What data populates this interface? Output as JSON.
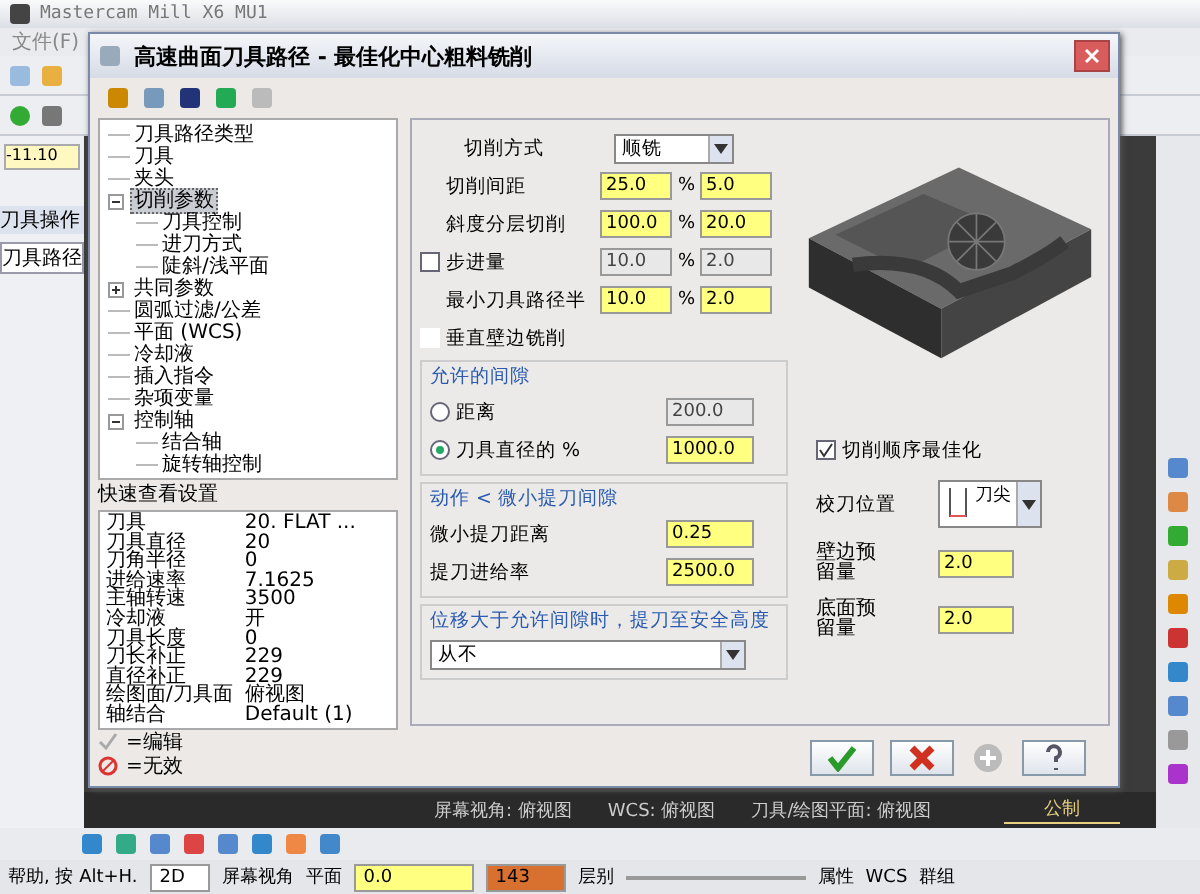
{
  "app": {
    "title": "Mastercam Mill X6 MU1",
    "menu": [
      "文件(F)"
    ],
    "coordinate": "-11.10",
    "manager_title": "刀具操作",
    "manager_tab": "刀具路径"
  },
  "dialog": {
    "title": "高速曲面刀具路径 - 最佳化中心粗料铣削",
    "tree": [
      {
        "label": "刀具路径类型",
        "selected": false
      },
      {
        "label": "刀具",
        "selected": false
      },
      {
        "label": "夹头",
        "selected": false
      },
      {
        "label": "切削参数",
        "selected": true,
        "expanded": true,
        "children": [
          {
            "label": "刀具控制",
            "selected": false
          },
          {
            "label": "进刀方式",
            "selected": false
          },
          {
            "label": "陡斜/浅平面",
            "selected": false
          }
        ]
      },
      {
        "label": "共同参数",
        "selected": false,
        "expanded": false
      },
      {
        "label": "圆弧过滤/公差",
        "selected": false
      },
      {
        "label": "平面 (WCS)",
        "selected": false
      },
      {
        "label": "冷却液",
        "selected": false
      },
      {
        "label": "插入指令",
        "selected": false
      },
      {
        "label": "杂项变量",
        "selected": false
      },
      {
        "label": "控制轴",
        "selected": false,
        "expanded": true,
        "children": [
          {
            "label": "结合轴",
            "selected": false
          },
          {
            "label": "旋转轴控制",
            "selected": false
          }
        ]
      }
    ],
    "quick_view": {
      "title": "快速查看设置",
      "rows": [
        [
          "刀具",
          "20. FLAT ..."
        ],
        [
          "刀具直径",
          "20"
        ],
        [
          "刀角半径",
          "0"
        ],
        [
          "进给速率",
          "7.1625"
        ],
        [
          "主轴转速",
          "3500"
        ],
        [
          "冷却液",
          "开"
        ],
        [
          "刀具长度",
          "0"
        ],
        [
          "刀长补正",
          "229"
        ],
        [
          "直径补正",
          "229"
        ],
        [
          "绘图面/刀具面",
          "俯视图"
        ],
        [
          "轴结合",
          "Default (1)"
        ]
      ]
    },
    "legend": [
      {
        "kind": "edit",
        "label": "=编辑"
      },
      {
        "kind": "invalid",
        "label": "=无效"
      }
    ],
    "cut_method": {
      "label": "切削方式",
      "value": "顺铣"
    },
    "rows": [
      {
        "kind": "plain",
        "label": "切削间距",
        "value": "25.0",
        "percent": "5.0",
        "disabled": false
      },
      {
        "kind": "plain",
        "label": "斜度分层切削",
        "value": "100.0",
        "percent": "20.0",
        "disabled": false
      },
      {
        "kind": "checkbox",
        "label": "步进量",
        "checked": false,
        "value": "10.0",
        "percent": "2.0",
        "disabled": true
      },
      {
        "kind": "plain",
        "label": "最小刀具路径半",
        "value": "10.0",
        "percent": "2.0",
        "disabled": false
      }
    ],
    "percent_sign": "%",
    "vertical_wall": {
      "label": "垂直壁边铣削",
      "checked": false
    },
    "gap": {
      "title": "允许的间隙",
      "options": [
        {
          "label": "距离",
          "value": "200.0",
          "selected": false
        },
        {
          "label": "刀具直径的 %",
          "value": "1000.0",
          "selected": true
        }
      ]
    },
    "motion": {
      "title": "动作 < 微小提刀间隙",
      "fields": [
        {
          "label": "微小提刀距离",
          "value": "0.25"
        },
        {
          "label": "提刀进给率",
          "value": "2500.0"
        }
      ]
    },
    "retract": {
      "title": "位移大于允许间隙时，提刀至安全高度",
      "value": "从不"
    },
    "optimize": {
      "label": "切削顺序最佳化",
      "checked": true
    },
    "compensation": {
      "label": "校刀位置",
      "value": "刀尖"
    },
    "stock": [
      {
        "label": "壁边预留量",
        "value": "2.0"
      },
      {
        "label": "底面预留量",
        "value": "2.0"
      }
    ],
    "buttons": [
      {
        "kind": "ok",
        "disabled": false
      },
      {
        "kind": "cancel",
        "disabled": false
      },
      {
        "kind": "add",
        "disabled": true
      },
      {
        "kind": "help",
        "disabled": false
      }
    ]
  },
  "viewport_status": [
    "屏幕视角: 俯视图",
    "WCS: 俯视图",
    "刀具/绘图平面: 俯视图"
  ],
  "scale_label": "公制",
  "status_bar": {
    "help": "帮助, 按 Alt+H.",
    "mode": "2D",
    "screen_view": "屏幕视角",
    "plane": "平面",
    "z_value": "0.0",
    "level": "143",
    "level_label": "层别",
    "attributes": "属性",
    "wcs": "WCS",
    "groups": "群组"
  }
}
